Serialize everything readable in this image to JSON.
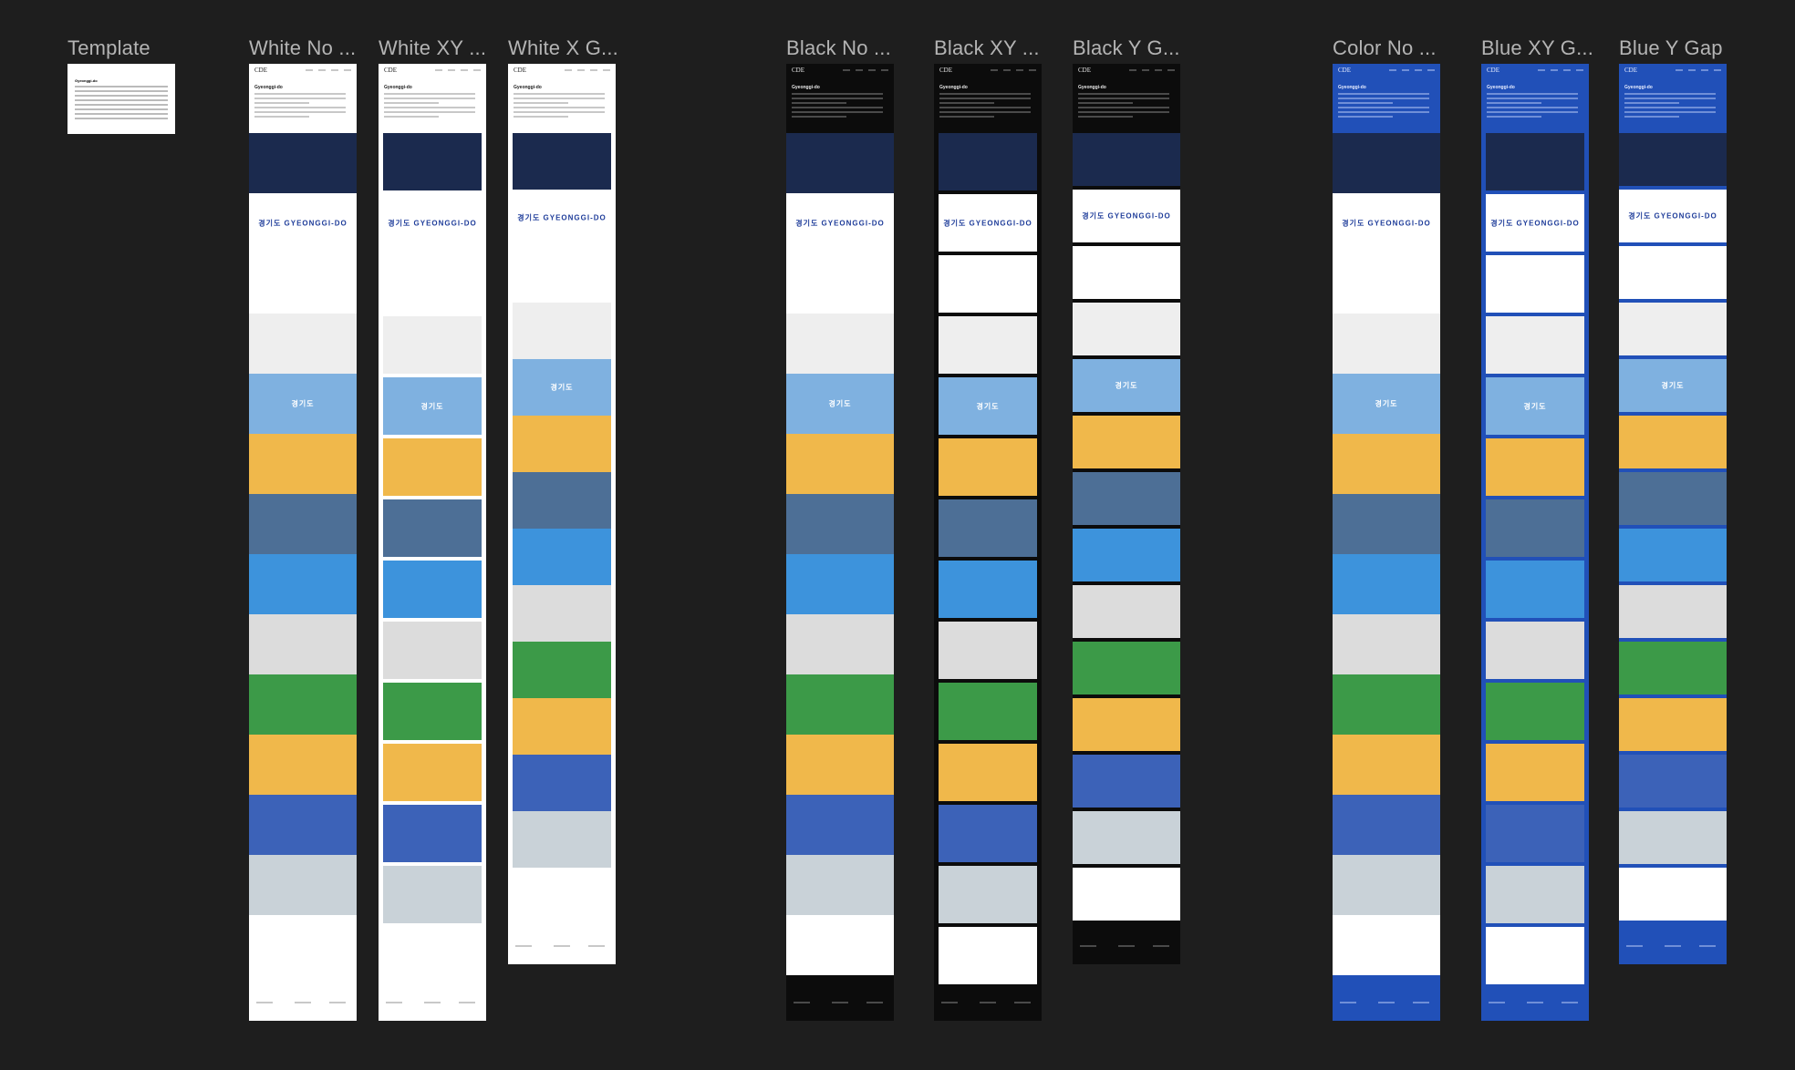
{
  "canvas": {
    "background": "#1e1e1e",
    "label_color": "#b4b4b4"
  },
  "template_frame": {
    "label": "Template",
    "heading": "Gyeonggi-do"
  },
  "frames": [
    {
      "label": "White No ...",
      "theme": "white",
      "gap": "none"
    },
    {
      "label": "White XY ...",
      "theme": "white",
      "gap": "xy"
    },
    {
      "label": "White X G...",
      "theme": "white",
      "gap": "x"
    },
    {
      "label": "Black No ...",
      "theme": "black",
      "gap": "none"
    },
    {
      "label": "Black XY ...",
      "theme": "black",
      "gap": "xy"
    },
    {
      "label": "Black Y G...",
      "theme": "black",
      "gap": "y"
    },
    {
      "label": "Color No ...",
      "theme": "blue",
      "gap": "none"
    },
    {
      "label": "Blue XY G...",
      "theme": "blue",
      "gap": "xy"
    },
    {
      "label": "Blue Y Gap",
      "theme": "blue",
      "gap": "y"
    }
  ],
  "frame_content": {
    "brand": "CDE",
    "heading": "Gyeonggi-do"
  },
  "themes": {
    "white": {
      "bg": "#ffffff",
      "fg": "#222222",
      "line": "#c8c8c8"
    },
    "black": {
      "bg": "#0c0c0c",
      "fg": "#e6e6e6",
      "line": "#4a4a4a"
    },
    "blue": {
      "bg": "#2150b8",
      "fg": "#e6ecff",
      "line": "#6f8fd8"
    }
  },
  "tiles": [
    {
      "name": "night-building-photo",
      "bg": "#1b2a4e",
      "logo": "",
      "logo_light": true
    },
    {
      "name": "logo-lockup",
      "bg": "#ffffff",
      "logo": "경기도  GYEONGGI-DO",
      "logo_light": false
    },
    {
      "name": "logo-variations",
      "bg": "#ffffff",
      "logo": "",
      "logo_light": false
    },
    {
      "name": "business-cards",
      "bg": "#eeeeee",
      "logo": "",
      "logo_light": false
    },
    {
      "name": "flag",
      "bg": "#7fb1e0",
      "logo": "경기도",
      "logo_light": true
    },
    {
      "name": "book-mockup",
      "bg": "#f0b84b",
      "logo": "",
      "logo_light": false
    },
    {
      "name": "poster-board",
      "bg": "#4d6f96",
      "logo": "",
      "logo_light": true
    },
    {
      "name": "tote-bags",
      "bg": "#3d93dc",
      "logo": "",
      "logo_light": false
    },
    {
      "name": "shopping-bags",
      "bg": "#dcdcdc",
      "logo": "",
      "logo_light": false
    },
    {
      "name": "badges",
      "bg": "#3c9a48",
      "logo": "",
      "logo_light": true
    },
    {
      "name": "cups",
      "bg": "#f0b84b",
      "logo": "",
      "logo_light": false
    },
    {
      "name": "t-shirts",
      "bg": "#3c62b8",
      "logo": "",
      "logo_light": true
    },
    {
      "name": "interior-pattern",
      "bg": "#c9d2d8",
      "logo": "",
      "logo_light": false
    },
    {
      "name": "car",
      "bg": "#ffffff",
      "logo": "",
      "logo_light": false
    }
  ]
}
